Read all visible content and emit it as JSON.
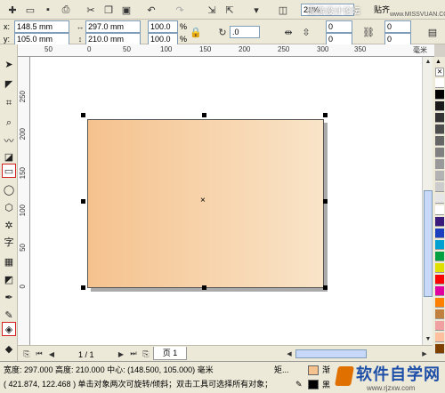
{
  "toolbar": {
    "zoom_value": "28%",
    "snap_label": "贴齐",
    "watermark": "思缘设计论坛",
    "watermark_url": "www.MISSVUAN.COM"
  },
  "property_bar": {
    "x_label": "x:",
    "x_value": "148.5 mm",
    "y_label": "y:",
    "y_value": "105.0 mm",
    "w_value": "297.0 mm",
    "h_value": "210.0 mm",
    "scale_x": "100.0",
    "scale_y": "100.0",
    "pct": "%",
    "rotate_value": ".0",
    "corner_values": [
      "0",
      "0",
      "0",
      "0"
    ]
  },
  "ruler": {
    "unit": "毫米",
    "h_ticks": [
      "50",
      "0",
      "50",
      "100",
      "150",
      "200",
      "250",
      "300",
      "350"
    ],
    "v_ticks": [
      "250",
      "200",
      "150",
      "100",
      "50",
      "0"
    ]
  },
  "rectangle": {
    "fill_from": "#f5c28e",
    "fill_to": "#f9e4c8",
    "shadow": "#aaaaaa"
  },
  "page_nav": {
    "current": "1 / 1",
    "tab_label": "页 1"
  },
  "palette": [
    "#ffffff",
    "#000000",
    "#1a1a1a",
    "#333333",
    "#4d4d4d",
    "#666666",
    "#808080",
    "#999999",
    "#b3b3b3",
    "#cccccc",
    "#e6e6e6",
    "#ffffff",
    "#3a1a7a",
    "#1a40c0",
    "#00a0d0",
    "#00a040",
    "#e0e000",
    "#ff0000",
    "#e000a0",
    "#ff8000",
    "#c08040",
    "#f0a0a0",
    "#ffc0a0",
    "#804000"
  ],
  "status": {
    "line1": "宽度: 297.000  高度: 210.000  中心: (148.500, 105.000)  毫米",
    "line2": "( 421.874, 122.468 )    单击对象两次可旋转/倾斜；双击工具可选择所有对象；",
    "shape_label": "矩...",
    "fill_label": "渐",
    "outline_label": "黑"
  },
  "logo": {
    "brand": "软件自学网",
    "url": "www.rjzxw.com"
  }
}
